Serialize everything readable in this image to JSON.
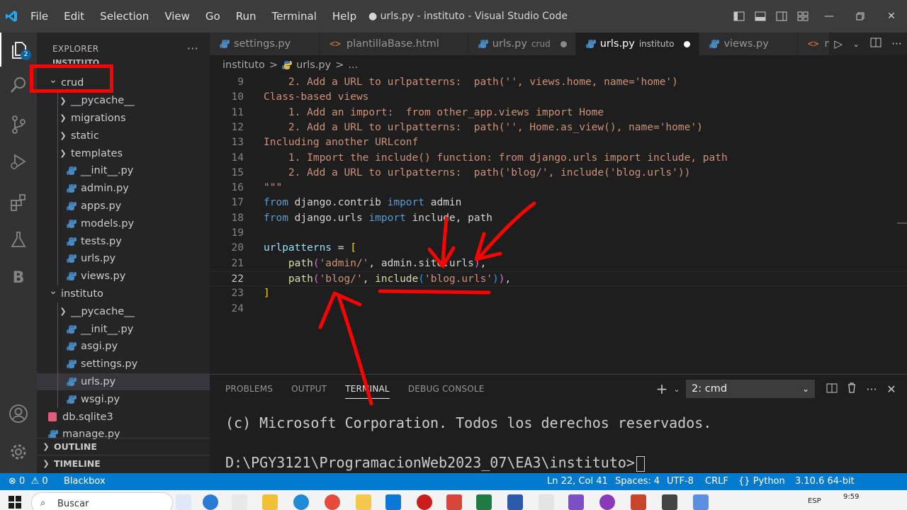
{
  "window": {
    "title": "● urls.py - instituto - Visual Studio Code",
    "menu": [
      "File",
      "Edit",
      "Selection",
      "View",
      "Go",
      "Run",
      "Terminal",
      "Help"
    ]
  },
  "activity": {
    "explorer_badge": "2",
    "b_label": "B"
  },
  "sidebar": {
    "header": "EXPLORER",
    "header_dots": "···",
    "workspace": "INSTITUTO",
    "tree": [
      {
        "label": "crud",
        "type": "folder-open",
        "depth": 0
      },
      {
        "label": "__pycache__",
        "type": "folder",
        "depth": 1
      },
      {
        "label": "migrations",
        "type": "folder",
        "depth": 1
      },
      {
        "label": "static",
        "type": "folder",
        "depth": 1
      },
      {
        "label": "templates",
        "type": "folder",
        "depth": 1
      },
      {
        "label": "__init__.py",
        "type": "py",
        "depth": 1
      },
      {
        "label": "admin.py",
        "type": "py",
        "depth": 1
      },
      {
        "label": "apps.py",
        "type": "py",
        "depth": 1
      },
      {
        "label": "models.py",
        "type": "py",
        "depth": 1
      },
      {
        "label": "tests.py",
        "type": "py",
        "depth": 1
      },
      {
        "label": "urls.py",
        "type": "py",
        "depth": 1
      },
      {
        "label": "views.py",
        "type": "py",
        "depth": 1
      },
      {
        "label": "instituto",
        "type": "folder-open",
        "depth": 0
      },
      {
        "label": "__pycache__",
        "type": "folder",
        "depth": 1
      },
      {
        "label": "__init__.py",
        "type": "py",
        "depth": 1
      },
      {
        "label": "asgi.py",
        "type": "py",
        "depth": 1
      },
      {
        "label": "settings.py",
        "type": "py",
        "depth": 1
      },
      {
        "label": "urls.py",
        "type": "py",
        "depth": 1,
        "selected": true
      },
      {
        "label": "wsgi.py",
        "type": "py",
        "depth": 1
      },
      {
        "label": "db.sqlite3",
        "type": "db",
        "depth": 0
      },
      {
        "label": "manage.py",
        "type": "py",
        "depth": 0
      }
    ],
    "outline": "OUTLINE",
    "timeline": "TIMELINE"
  },
  "tabs": [
    {
      "label": "settings.py",
      "desc": "",
      "icon": "python-icon"
    },
    {
      "label": "plantillaBase.html",
      "desc": "",
      "icon": "html-icon"
    },
    {
      "label": "urls.py",
      "desc": "crud",
      "icon": "python-icon",
      "modified": true
    },
    {
      "label": "urls.py",
      "desc": "instituto",
      "icon": "python-icon",
      "modified": true,
      "active": true
    },
    {
      "label": "views.py",
      "desc": "",
      "icon": "python-icon"
    },
    {
      "label": "marca.htm",
      "desc": "",
      "icon": "html-icon"
    }
  ],
  "breadcrumb": [
    "instituto",
    ">",
    "urls.py",
    ">",
    "..."
  ],
  "code": {
    "current_line": 22,
    "lines": [
      {
        "n": "9",
        "parts": [
          [
            "s-str",
            "    2. Add a URL to urlpatterns:  path('', views.home, name='home')"
          ]
        ]
      },
      {
        "n": "10",
        "parts": [
          [
            "s-str",
            "Class-based views"
          ]
        ]
      },
      {
        "n": "11",
        "parts": [
          [
            "s-str",
            "    1. Add an import:  from other_app.views import Home"
          ]
        ]
      },
      {
        "n": "12",
        "parts": [
          [
            "s-str",
            "    2. Add a URL to urlpatterns:  path('', Home.as_view(), name='home')"
          ]
        ]
      },
      {
        "n": "13",
        "parts": [
          [
            "s-str",
            "Including another URLconf"
          ]
        ]
      },
      {
        "n": "14",
        "parts": [
          [
            "s-str",
            "    1. Import the include() function: from django.urls import include, path"
          ]
        ]
      },
      {
        "n": "15",
        "parts": [
          [
            "s-str",
            "    2. Add a URL to urlpatterns:  path('blog/', include('blog.urls'))"
          ]
        ]
      },
      {
        "n": "16",
        "parts": [
          [
            "s-str",
            "\"\"\""
          ]
        ]
      },
      {
        "n": "17",
        "parts": [
          [
            "s-kw",
            "from"
          ],
          [
            "s-plain",
            " django.contrib "
          ],
          [
            "s-kw",
            "import"
          ],
          [
            "s-plain",
            " admin"
          ]
        ]
      },
      {
        "n": "18",
        "parts": [
          [
            "s-kw",
            "from"
          ],
          [
            "s-plain",
            " django.urls "
          ],
          [
            "s-kw",
            "import"
          ],
          [
            "s-plain",
            " include, path"
          ]
        ]
      },
      {
        "n": "19",
        "parts": []
      },
      {
        "n": "20",
        "parts": [
          [
            "s-var",
            "urlpatterns"
          ],
          [
            "s-plain",
            " = "
          ],
          [
            "s-br",
            "["
          ]
        ]
      },
      {
        "n": "21",
        "parts": [
          [
            "s-plain",
            "    "
          ],
          [
            "s-fn",
            "path"
          ],
          [
            "s-br2",
            "("
          ],
          [
            "s-str",
            "'admin/'"
          ],
          [
            "s-plain",
            ", admin.site.urls"
          ],
          [
            "s-br2",
            ")"
          ],
          [
            "s-plain",
            ","
          ]
        ]
      },
      {
        "n": "22",
        "parts": [
          [
            "s-plain",
            "    "
          ],
          [
            "s-fn",
            "path"
          ],
          [
            "s-br2",
            "("
          ],
          [
            "s-str",
            "'blog/'"
          ],
          [
            "s-plain",
            ", "
          ],
          [
            "s-fn",
            "include"
          ],
          [
            "s-br3",
            "("
          ],
          [
            "s-str",
            "'blog.urls'"
          ],
          [
            "s-br3",
            ")"
          ],
          [
            "s-br2",
            ")"
          ],
          [
            "s-plain",
            ","
          ]
        ]
      },
      {
        "n": "23",
        "parts": [
          [
            "s-br",
            "]"
          ]
        ]
      },
      {
        "n": "24",
        "parts": []
      }
    ]
  },
  "panel": {
    "tabs": [
      "PROBLEMS",
      "OUTPUT",
      "TERMINAL",
      "DEBUG CONSOLE"
    ],
    "active_tab": "TERMINAL",
    "terminal_select": "2: cmd",
    "lines": [
      "(c) Microsoft Corporation. Todos los derechos reservados.",
      "D:\\PGY3121\\ProgramacionWeb2023_07\\EA3\\instituto>"
    ]
  },
  "status": {
    "errors": "0",
    "warnings": "0",
    "blackbox": "Blackbox",
    "position": "Ln 22, Col 41",
    "spaces": "Spaces: 4",
    "encoding": "UTF-8",
    "eol": "CRLF",
    "language": "Python",
    "interpreter": "3.10.6 64-bit"
  },
  "taskbar": {
    "search": "Buscar",
    "time": "9:59",
    "lang": "ESP"
  },
  "colors": {
    "accent": "#007acc",
    "annotation": "#ff0000",
    "string": "#ce9178",
    "keyword": "#569cd6"
  }
}
